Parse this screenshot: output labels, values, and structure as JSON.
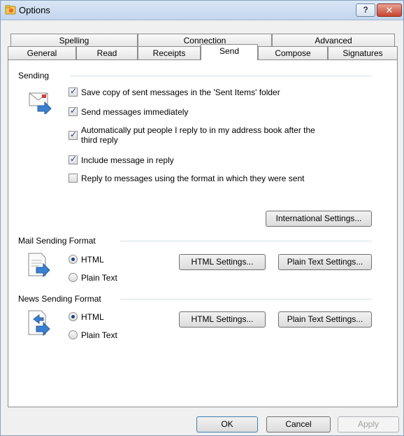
{
  "window": {
    "title": "Options"
  },
  "tabs_row1": [
    {
      "label": "Spelling"
    },
    {
      "label": "Connection"
    },
    {
      "label": "Advanced"
    }
  ],
  "tabs_row2": [
    {
      "label": "General"
    },
    {
      "label": "Read"
    },
    {
      "label": "Receipts"
    },
    {
      "label": "Send",
      "active": true
    },
    {
      "label": "Compose"
    },
    {
      "label": "Signatures"
    }
  ],
  "sending": {
    "label": "Sending",
    "options": [
      {
        "label": "Save copy of sent messages in the 'Sent Items' folder",
        "checked": true
      },
      {
        "label": "Send messages immediately",
        "checked": true
      },
      {
        "label_line1": "Automatically put people I reply to in my address book after the",
        "label_line2": "third reply",
        "checked": true
      },
      {
        "label": "Include message in reply",
        "checked": true
      },
      {
        "label": "Reply to messages using the format in which they were sent",
        "checked": false
      }
    ],
    "international_button": "International Settings..."
  },
  "mail_format": {
    "label": "Mail Sending Format",
    "html_option": "HTML",
    "plain_option": "Plain Text",
    "selected": "HTML",
    "html_settings_button": "HTML Settings...",
    "plain_settings_button": "Plain Text Settings..."
  },
  "news_format": {
    "label": "News Sending Format",
    "html_option": "HTML",
    "plain_option": "Plain Text",
    "selected": "HTML",
    "html_settings_button": "HTML Settings...",
    "plain_settings_button": "Plain Text Settings..."
  },
  "footer": {
    "ok": "OK",
    "cancel": "Cancel",
    "apply": "Apply"
  },
  "colors": {
    "accent": "#1f3e8c",
    "close_button": "#c8452f",
    "titlebar": "#c3d6ee"
  }
}
